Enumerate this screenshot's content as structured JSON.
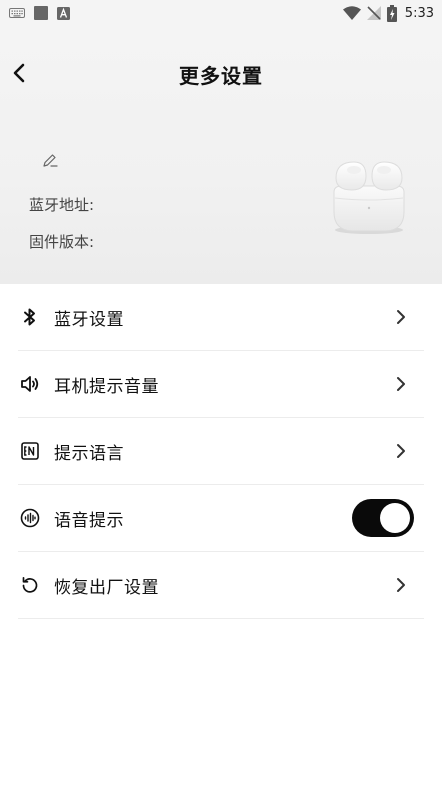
{
  "status_bar": {
    "time": "5:33",
    "icons": [
      "keyboard-icon",
      "square-icon",
      "a-icon",
      "wifi-icon",
      "no-signal-icon",
      "battery-icon"
    ]
  },
  "header": {
    "title": "更多设置",
    "bluetooth_address_label": "蓝牙地址:",
    "firmware_version_label": "固件版本:"
  },
  "settings": {
    "items": [
      {
        "label": "蓝牙设置",
        "icon": "bluetooth-icon",
        "control": "chevron"
      },
      {
        "label": "耳机提示音量",
        "icon": "volume-icon",
        "control": "chevron"
      },
      {
        "label": "提示语言",
        "icon": "language-en-icon",
        "control": "chevron"
      },
      {
        "label": "语音提示",
        "icon": "voice-icon",
        "control": "toggle",
        "enabled": true
      },
      {
        "label": "恢复出厂设置",
        "icon": "reset-icon",
        "control": "chevron"
      }
    ]
  },
  "colors": {
    "header_bg": "#f2f2f2",
    "toggle_on": "#0a0a0a",
    "divider": "#ececec",
    "text_primary": "#111111",
    "text_secondary": "#444444"
  }
}
